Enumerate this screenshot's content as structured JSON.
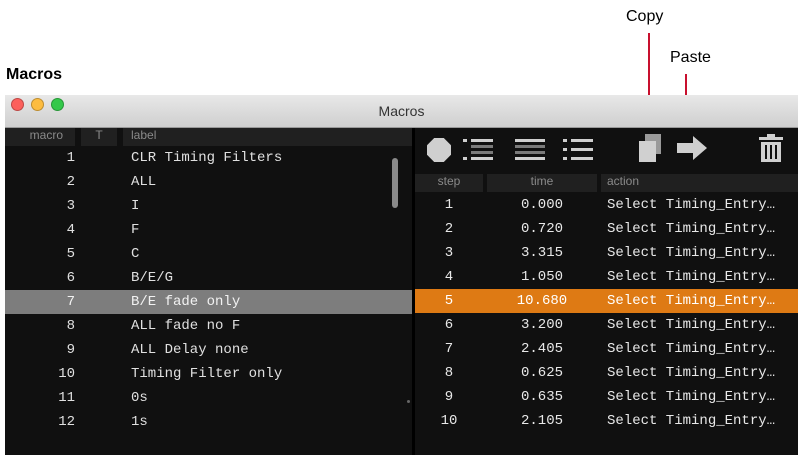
{
  "callouts": {
    "copy": "Copy",
    "paste": "Paste"
  },
  "heading": "Macros",
  "window": {
    "title": "Macros"
  },
  "left_table": {
    "headers": {
      "macro": "macro",
      "t": "T",
      "label": "label"
    },
    "rows": [
      {
        "num": "1",
        "label": "CLR Timing Filters"
      },
      {
        "num": "2",
        "label": "ALL"
      },
      {
        "num": "3",
        "label": "I"
      },
      {
        "num": "4",
        "label": "F"
      },
      {
        "num": "5",
        "label": "C"
      },
      {
        "num": "6",
        "label": "B/E/G"
      },
      {
        "num": "7",
        "label": "B/E fade only"
      },
      {
        "num": "8",
        "label": "ALL fade no F"
      },
      {
        "num": "9",
        "label": "ALL Delay none"
      },
      {
        "num": "10",
        "label": "Timing Filter only"
      },
      {
        "num": "11",
        "label": "0s"
      },
      {
        "num": "12",
        "label": "1s"
      }
    ],
    "selected_index": 6
  },
  "toolbar": {
    "icons": [
      "record-icon",
      "list-insert-icon",
      "list-replace-icon",
      "list-icon",
      "copy-icon",
      "paste-icon",
      "trash-icon"
    ]
  },
  "right_table": {
    "headers": {
      "step": "step",
      "time": "time",
      "action": "action"
    },
    "rows": [
      {
        "step": "1",
        "time": "0.000",
        "action": "Select Timing_Entry…"
      },
      {
        "step": "2",
        "time": "0.720",
        "action": "Select Timing_Entry…"
      },
      {
        "step": "3",
        "time": "3.315",
        "action": "Select Timing_Entry…"
      },
      {
        "step": "4",
        "time": "1.050",
        "action": "Select Timing_Entry…"
      },
      {
        "step": "5",
        "time": "10.680",
        "action": "Select Timing_Entry…"
      },
      {
        "step": "6",
        "time": "3.200",
        "action": "Select Timing_Entry…"
      },
      {
        "step": "7",
        "time": "2.405",
        "action": "Select Timing_Entry…"
      },
      {
        "step": "8",
        "time": "0.625",
        "action": "Select Timing_Entry…"
      },
      {
        "step": "9",
        "time": "0.635",
        "action": "Select Timing_Entry…"
      },
      {
        "step": "10",
        "time": "2.105",
        "action": "Select Timing_Entry…"
      }
    ],
    "selected_index": 4
  },
  "colors": {
    "selection_left": "#7d7d7d",
    "selection_right": "#de7a14",
    "callout_line": "#c8102e",
    "background": "#101010"
  }
}
